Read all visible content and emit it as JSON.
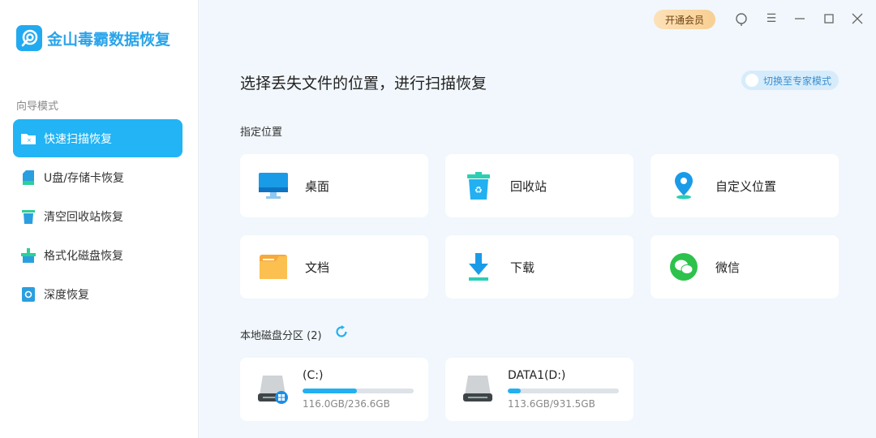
{
  "app": {
    "title": "金山毒霸数据恢复"
  },
  "sidebar": {
    "section": "向导模式",
    "items": [
      {
        "label": "快速扫描恢复",
        "icon": "folder-icon",
        "active": true
      },
      {
        "label": "U盘/存储卡恢复",
        "icon": "sd-card-icon"
      },
      {
        "label": "清空回收站恢复",
        "icon": "recycle-bin-icon"
      },
      {
        "label": "格式化磁盘恢复",
        "icon": "broom-icon"
      },
      {
        "label": "深度恢复",
        "icon": "deep-scan-icon"
      }
    ]
  },
  "topbar": {
    "vip": "开通会员"
  },
  "main": {
    "title": "选择丢失文件的位置，进行扫描恢复",
    "expert_toggle": "切换至专家模式",
    "locations_label": "指定位置",
    "locations": [
      {
        "label": "桌面"
      },
      {
        "label": "回收站"
      },
      {
        "label": "自定义位置"
      },
      {
        "label": "文档"
      },
      {
        "label": "下载"
      },
      {
        "label": "微信"
      }
    ],
    "disks_label": "本地磁盘分区 (2)",
    "disks": [
      {
        "name": "(C:)",
        "size": "116.0GB/236.6GB",
        "used_pct": 49,
        "system": true
      },
      {
        "name": "DATA1(D:)",
        "size": "113.6GB/931.5GB",
        "used_pct": 12
      }
    ]
  },
  "colors": {
    "accent": "#22b4f5"
  }
}
